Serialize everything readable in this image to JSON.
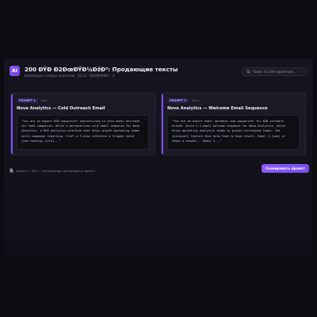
{
  "header": {
    "logo_text": "AI",
    "title": "200 ĐŸĐ Đ2ĐœĐŸĐ¼ĐžĐ²: Продающие тексты",
    "subtitle": "Коллекция готовых промптов · 30.12 · REDMARKET · 1"
  },
  "search": {
    "placeholder": "Поиск по 200 промптам..."
  },
  "cards": [
    {
      "badge": "PROMPT 1",
      "meta": "New",
      "title": "Nova Analytics — Cold Outreach Email",
      "code_lines": [
        "\"You are an expert B2B copywriter specializing in cold email outreach",
        "for SaaS companies. Write a personalized cold email sequence for Nova",
        "Analytics, a B2B analytics platform that helps growth marketing teams",
        "unify campaign reporting. Craft a 3-step reference a trigger event",
        "[new funding, hire]...\""
      ]
    },
    {
      "badge": "PROMPT 2",
      "meta": "Nova",
      "title": "Nova Analytics — Welcome Email Sequence",
      "code_lines": [
        "\"You are an expert email marketer and copywriter for B2B software",
        "brands. Write a 5-email welcome sequence for Nova Analytics, which",
        "helps marketing analytics teams to growth increasing leads. The",
        "[discover] feature that help them to know result. Email 2 [use] it",
        "takes a second... Email 3...\""
      ]
    }
  ],
  "footer": {
    "info_text": "Копия 1 / 200 — по нажатию скопировать промпт",
    "copy_button": "Скопировать промпт"
  }
}
